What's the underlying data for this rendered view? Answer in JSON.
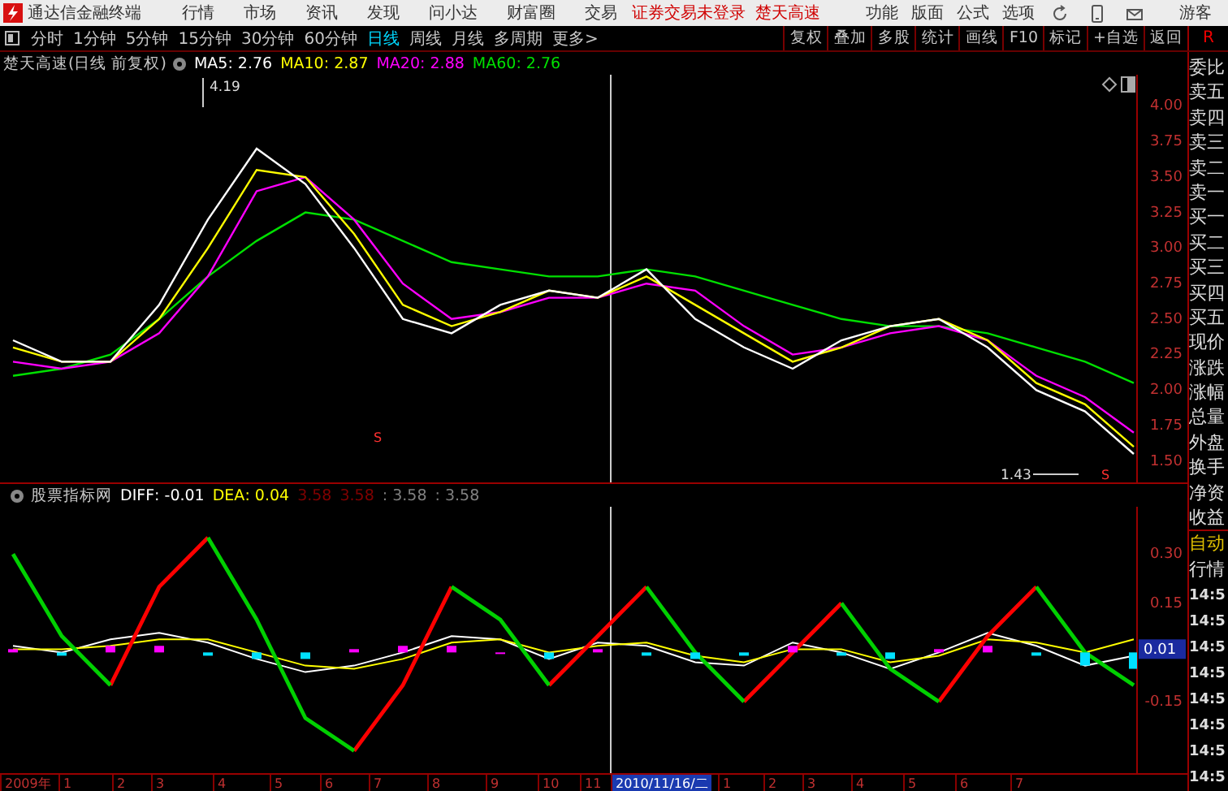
{
  "menu_bar": {
    "app_title": "通达信金融终端",
    "menus": [
      "行情",
      "市场",
      "资讯",
      "发现",
      "问小达",
      "财富圈",
      "交易"
    ],
    "status_texts": [
      "证券交易未登录",
      "楚天高速"
    ],
    "right_menus": [
      "功能",
      "版面",
      "公式",
      "选项"
    ],
    "user": "游客"
  },
  "toolbar": {
    "periods": [
      {
        "label": "分时",
        "selected": false
      },
      {
        "label": "1分钟",
        "selected": false
      },
      {
        "label": "5分钟",
        "selected": false
      },
      {
        "label": "15分钟",
        "selected": false
      },
      {
        "label": "30分钟",
        "selected": false
      },
      {
        "label": "60分钟",
        "selected": false
      },
      {
        "label": "日线",
        "selected": true
      },
      {
        "label": "周线",
        "selected": false
      },
      {
        "label": "月线",
        "selected": false
      },
      {
        "label": "多周期",
        "selected": false
      },
      {
        "label": "更多>",
        "selected": false
      }
    ],
    "buttons": [
      "复权",
      "叠加",
      "多股",
      "统计",
      "画线",
      "F10",
      "标记",
      "+自选",
      "返回"
    ],
    "panel_tag": "R"
  },
  "price_panel": {
    "title": "楚天高速(日线 前复权)",
    "readings": [
      ": 2.76",
      ": 2.87",
      ": 2.88",
      ": 2.76"
    ],
    "annotations": [
      "4.19",
      "1.43"
    ],
    "markers": [
      "S",
      "S"
    ],
    "chart_data": {
      "type": "line",
      "ylim": [
        1.35,
        4.22
      ],
      "yticks": [
        {
          "value": 1.5,
          "label": "1.50"
        },
        {
          "value": 1.75,
          "label": "1.75"
        },
        {
          "value": 2,
          "label": "2.00"
        },
        {
          "value": 2.25,
          "label": "2.25"
        },
        {
          "value": 2.5,
          "label": "2.50"
        },
        {
          "value": 2.75,
          "label": "2.75"
        },
        {
          "value": 3,
          "label": "3.00"
        },
        {
          "value": 3.25,
          "label": "3.25"
        },
        {
          "value": 3.5,
          "label": "3.50"
        },
        {
          "value": 3.75,
          "label": "3.75"
        },
        {
          "value": 4,
          "label": "4.00"
        }
      ],
      "series": [
        {
          "name": "MA5",
          "color": "#ffffff",
          "values": [
            2.35,
            2.2,
            2.2,
            2.6,
            3.2,
            3.7,
            3.45,
            3.0,
            2.5,
            2.4,
            2.6,
            2.7,
            2.65,
            2.85,
            2.5,
            2.3,
            2.15,
            2.35,
            2.45,
            2.5,
            2.3,
            2.0,
            1.85,
            1.55
          ]
        },
        {
          "name": "MA10",
          "color": "#ffff00",
          "values": [
            2.3,
            2.2,
            2.2,
            2.5,
            3.0,
            3.55,
            3.5,
            3.1,
            2.6,
            2.45,
            2.55,
            2.7,
            2.65,
            2.8,
            2.6,
            2.4,
            2.2,
            2.3,
            2.45,
            2.5,
            2.35,
            2.05,
            1.9,
            1.6
          ]
        },
        {
          "name": "MA20",
          "color": "#ff00ff",
          "values": [
            2.2,
            2.15,
            2.2,
            2.4,
            2.8,
            3.4,
            3.5,
            3.2,
            2.75,
            2.5,
            2.55,
            2.65,
            2.65,
            2.75,
            2.7,
            2.45,
            2.25,
            2.3,
            2.4,
            2.45,
            2.35,
            2.1,
            1.95,
            1.7
          ]
        },
        {
          "name": "MA60",
          "color": "#00e000",
          "values": [
            2.1,
            2.15,
            2.25,
            2.5,
            2.8,
            3.05,
            3.25,
            3.2,
            3.05,
            2.9,
            2.85,
            2.8,
            2.8,
            2.85,
            2.8,
            2.7,
            2.6,
            2.5,
            2.45,
            2.45,
            2.4,
            2.3,
            2.2,
            2.05
          ]
        }
      ]
    }
  },
  "indicator_panel": {
    "title": "股票指标网",
    "readings": [
      ": -0.01",
      ": 0.04"
    ],
    "extra_readouts": [
      {
        "text": "3.58",
        "color": "#800000"
      },
      {
        "text": "3.58",
        "color": "#800000"
      },
      {
        "text": ": 3.58",
        "color": "#808080"
      },
      {
        "text": ": 3.58",
        "color": "#808080"
      }
    ],
    "current_value": "0.01",
    "chart_data": {
      "type": "line",
      "ylim": [
        -0.368,
        0.444
      ],
      "yticks": [
        {
          "value": -0.15,
          "label": "-0.15"
        },
        {
          "value": 0.15,
          "label": "0.15"
        },
        {
          "value": 0.3,
          "label": "0.30"
        }
      ],
      "series": [
        {
          "name": "DIFF",
          "color": "#ffffff",
          "values": [
            0.02,
            0.0,
            0.04,
            0.06,
            0.03,
            -0.02,
            -0.06,
            -0.04,
            0.0,
            0.05,
            0.04,
            -0.02,
            0.03,
            0.02,
            -0.03,
            -0.04,
            0.03,
            0.0,
            -0.05,
            0.0,
            0.06,
            0.02,
            -0.04,
            -0.01
          ]
        },
        {
          "name": "DEA",
          "color": "#ffff00",
          "values": [
            0.01,
            0.01,
            0.02,
            0.04,
            0.04,
            0.0,
            -0.04,
            -0.05,
            -0.02,
            0.03,
            0.04,
            0.0,
            0.02,
            0.03,
            -0.01,
            -0.03,
            0.01,
            0.01,
            -0.03,
            -0.01,
            0.04,
            0.03,
            0.0,
            0.04
          ]
        },
        {
          "color": "#ff0000",
          "values": [
            null,
            null,
            -0.1,
            0.2,
            0.35,
            null,
            null,
            -0.3,
            -0.1,
            0.2,
            null,
            -0.1,
            0.05,
            0.2,
            null,
            -0.15,
            0.0,
            0.15,
            null,
            -0.15,
            0.05,
            0.2,
            null,
            null
          ]
        },
        {
          "color": "#00d000",
          "values": [
            0.3,
            0.05,
            -0.1,
            null,
            0.35,
            0.1,
            -0.2,
            -0.3,
            null,
            0.2,
            0.1,
            -0.1,
            null,
            0.2,
            0.0,
            -0.15,
            null,
            0.15,
            -0.05,
            -0.15,
            null,
            0.2,
            0.0,
            -0.1
          ]
        }
      ]
    }
  },
  "date_axis": [
    {
      "label": "2009年",
      "selected": false
    },
    {
      "label": "1",
      "selected": false
    },
    {
      "label": "2",
      "selected": false
    },
    {
      "label": "3",
      "selected": false
    },
    {
      "label": "4",
      "selected": false
    },
    {
      "label": "5",
      "selected": false
    },
    {
      "label": "6",
      "selected": false
    },
    {
      "label": "7",
      "selected": false
    },
    {
      "label": "8",
      "selected": false
    },
    {
      "label": "9",
      "selected": false
    },
    {
      "label": "10",
      "selected": false
    },
    {
      "label": "11",
      "selected": false
    },
    {
      "label": "2010/11/16/二",
      "selected": true
    },
    {
      "label": "1",
      "selected": false
    },
    {
      "label": "2",
      "selected": false
    },
    {
      "label": "3",
      "selected": false
    },
    {
      "label": "4",
      "selected": false
    },
    {
      "label": "5",
      "selected": false
    },
    {
      "label": "6",
      "selected": false
    },
    {
      "label": "7",
      "selected": false
    }
  ],
  "quote_panel": {
    "fields": [
      "委比",
      "卖五",
      "卖四",
      "卖三",
      "卖二",
      "卖一",
      "买一",
      "买二",
      "买三",
      "买四",
      "买五",
      "现价",
      "涨跌",
      "涨幅",
      "总量",
      "外盘",
      "换手",
      "净资",
      "收益"
    ],
    "mode": "自动",
    "section": "行情",
    "ticks": [
      "14:5",
      "14:5",
      "14:5",
      "14:5",
      "14:5",
      "14:5",
      "14:5",
      "14:5"
    ]
  }
}
